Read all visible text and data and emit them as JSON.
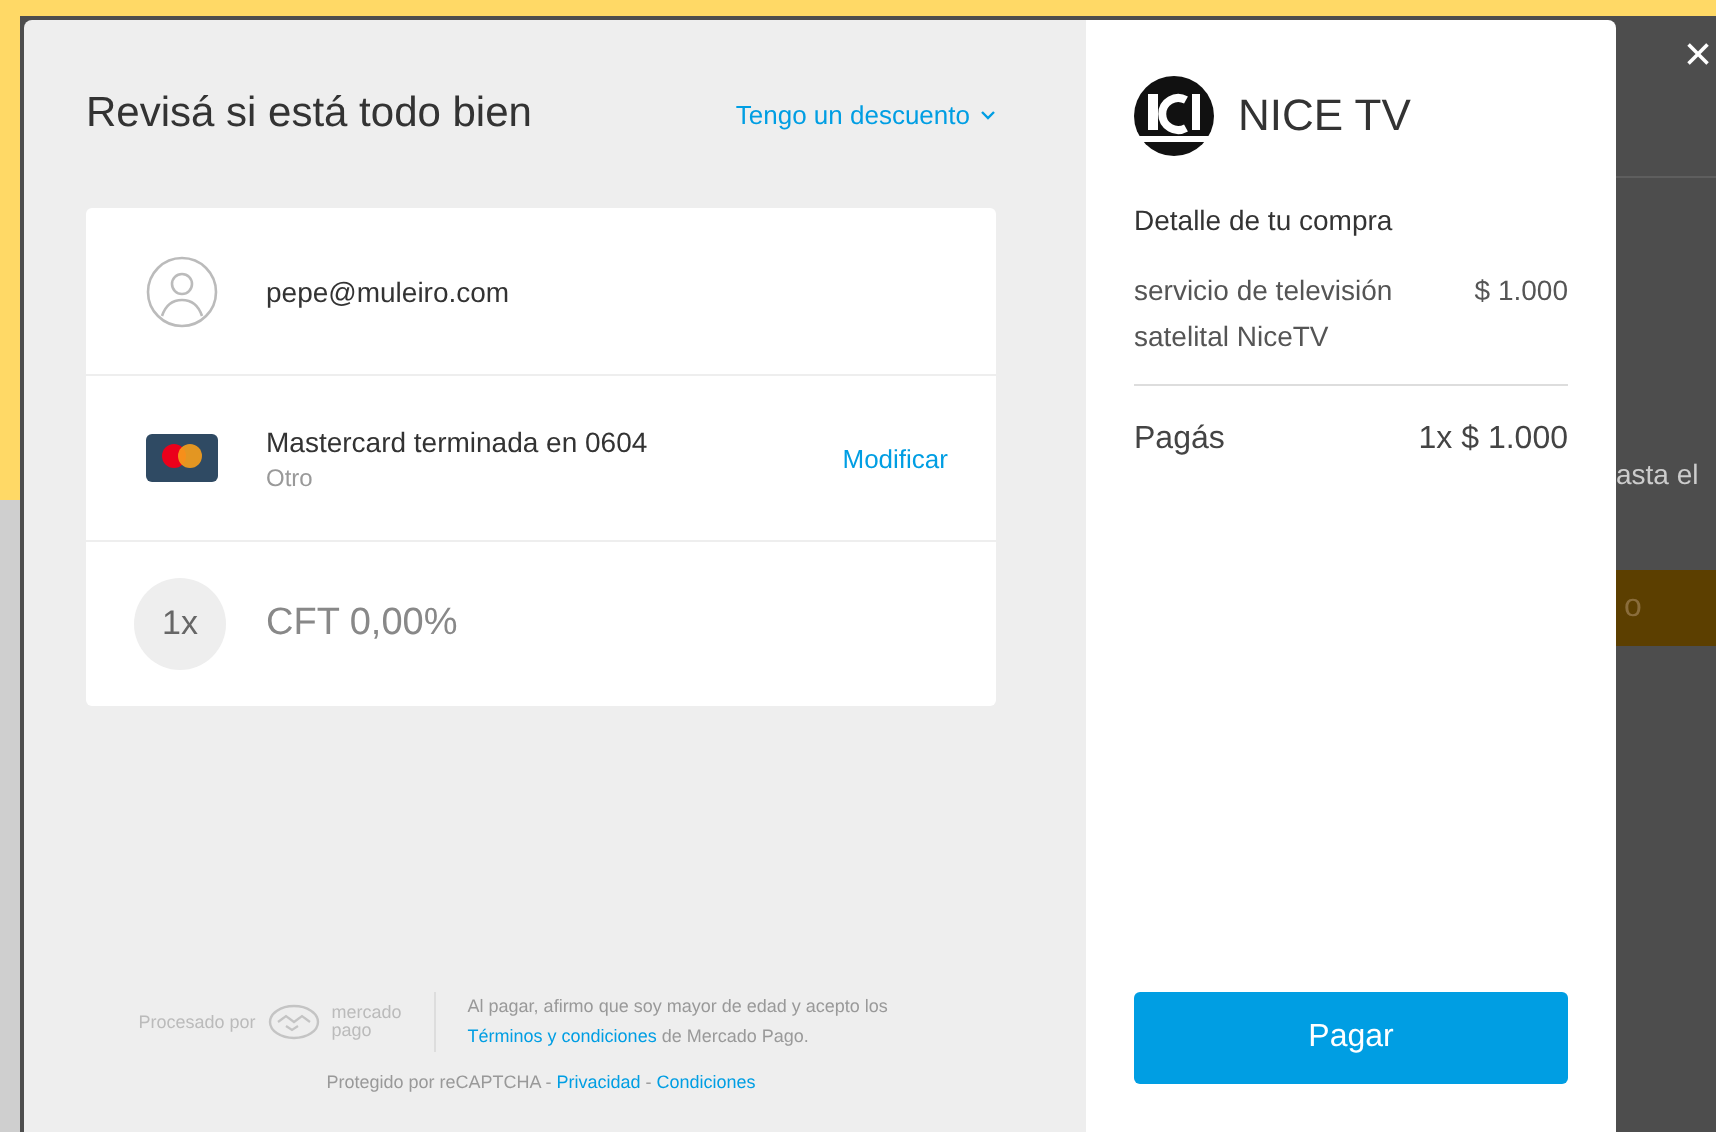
{
  "header": {
    "title": "Revisá si está todo bien",
    "discount_link": "Tengo un descuento"
  },
  "rows": [
    {
      "kind": "user",
      "text": "pepe@muleiro.com"
    },
    {
      "kind": "card",
      "text": "Mastercard terminada en 0604",
      "subtext": "Otro",
      "action": "Modificar"
    },
    {
      "kind": "installments",
      "badge": "1x",
      "text": "CFT 0,00%"
    }
  ],
  "footer": {
    "processed_by": "Procesado por",
    "brand": [
      "mercado",
      "pago"
    ],
    "legal_before": "Al pagar, afirmo que soy mayor de edad y acepto los",
    "terms_link": "Términos y condiciones",
    "legal_after": "de Mercado Pago.",
    "recaptcha": "Protegido por reCAPTCHA -",
    "privacy_link": "Privacidad",
    "separator": "-",
    "conditions_link": "Condiciones"
  },
  "summary": {
    "merchant": "NICE TV",
    "title": "Detalle de tu compra",
    "items": [
      {
        "name": "servicio de televisión satelital NiceTV",
        "price": "$ 1.000"
      }
    ],
    "total_label": "Pagás",
    "total": "1x $ 1.000",
    "pay_button": "Pagar"
  },
  "background": {
    "close": "×",
    "text": "asta el",
    "button": "o"
  }
}
